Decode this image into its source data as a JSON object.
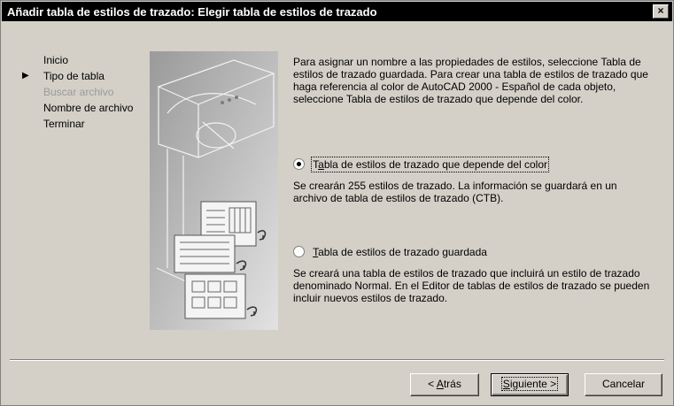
{
  "dialog": {
    "title": "Añadir tabla de estilos de trazado: Elegir tabla de estilos de trazado",
    "close_symbol": "×"
  },
  "nav": {
    "items": [
      {
        "label": "Inicio",
        "state": "done"
      },
      {
        "label": "Tipo de tabla",
        "state": "current"
      },
      {
        "label": "Buscar archivo",
        "state": "disabled"
      },
      {
        "label": "Nombre de archivo",
        "state": "normal"
      },
      {
        "label": "Terminar",
        "state": "normal"
      }
    ],
    "arrow_icon": "▶"
  },
  "content": {
    "intro": "Para asignar un nombre a las propiedades de estilos, seleccione Tabla de estilos de trazado guardada. Para crear una tabla de estilos de trazado que haga referencia al color de AutoCAD 2000 - Español de cada objeto, seleccione Tabla de estilos de trazado que depende del color.",
    "options": [
      {
        "label_pre": "T",
        "label_u": "a",
        "label_post": "bla de estilos de trazado que depende del color",
        "checked": true,
        "description": "Se crearán 255 estilos de trazado. La información se guardará en un archivo de tabla de estilos de trazado (CTB)."
      },
      {
        "label_pre": "",
        "label_u": "T",
        "label_post": "abla de estilos de trazado guardada",
        "checked": false,
        "description": "Se creará una tabla de estilos de trazado que incluirá un estilo de trazado denominado Normal. En el Editor de tablas de estilos de trazado se pueden incluir nuevos estilos de trazado."
      }
    ]
  },
  "buttons": {
    "back": {
      "pre": "< ",
      "u": "A",
      "post": "trás"
    },
    "next": {
      "pre": "",
      "u": "S",
      "post": "iguiente >"
    },
    "cancel": "Cancelar"
  }
}
